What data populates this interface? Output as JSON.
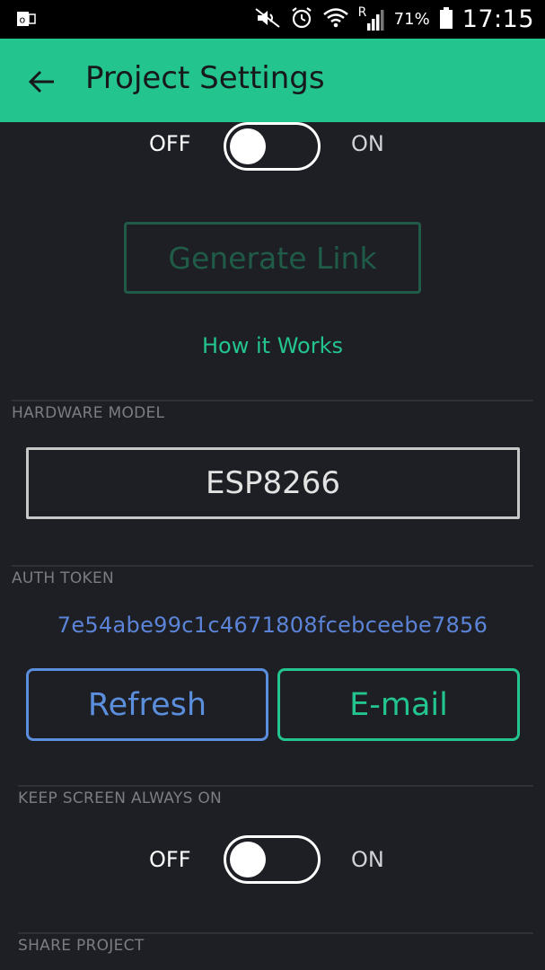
{
  "status_bar": {
    "battery_percent": "71%",
    "time": "17:15",
    "signal_roaming": "R"
  },
  "app_bar": {
    "title": "Project Settings"
  },
  "top_toggle": {
    "off_label": "OFF",
    "on_label": "ON",
    "state": "off"
  },
  "generate_link": {
    "label": "Generate Link"
  },
  "how_it_works": {
    "label": "How it Works"
  },
  "hardware_model": {
    "section_label": "HARDWARE MODEL",
    "value": "ESP8266"
  },
  "auth_token": {
    "section_label": "AUTH TOKEN",
    "value": "7e54abe99c1c4671808fcebceebe7856",
    "refresh_label": "Refresh",
    "email_label": "E-mail"
  },
  "keep_screen_on": {
    "section_label": "KEEP SCREEN ALWAYS ON",
    "off_label": "OFF",
    "on_label": "ON",
    "state": "off"
  },
  "share_project": {
    "section_label": "SHARE PROJECT"
  },
  "colors": {
    "accent": "#23c48e",
    "background": "#1e1f24",
    "refresh_blue": "#5b8edc",
    "token_blue": "#5b84d8"
  }
}
